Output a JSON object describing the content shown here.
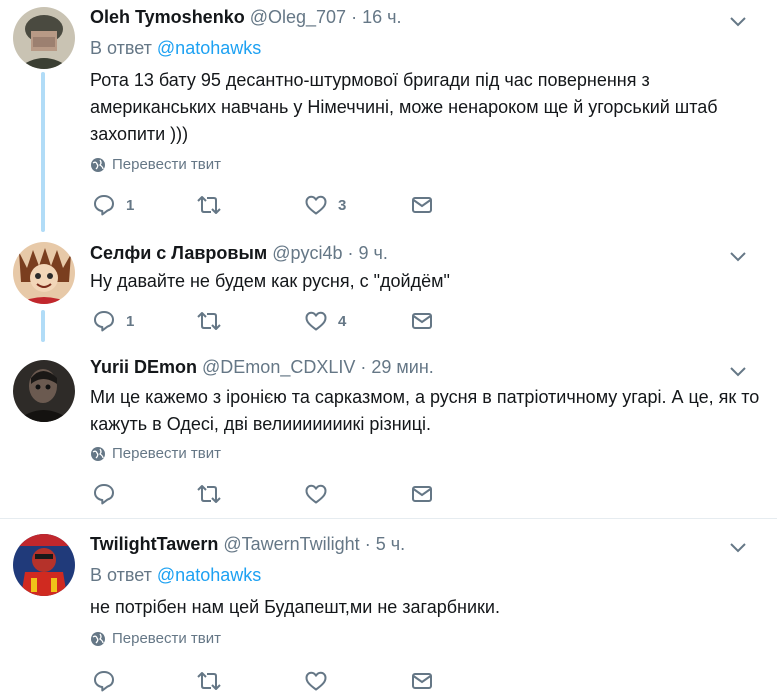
{
  "tweets": [
    {
      "name": "Oleh Tymoshenko",
      "handle": "@Oleg_707",
      "dot": "·",
      "time": "16 ч.",
      "reply_prefix": "В ответ",
      "reply_to": "@natohawks",
      "text": "Рота 13 бату 95 десантно-штурмової бригади під час повернення з американських навчань у Німеччині, може ненароком ще й угорський штаб захопити )))",
      "translate": "Перевести твит",
      "replies": "1",
      "retweets": "",
      "likes": "3"
    },
    {
      "name": "Селфи с Лавровым",
      "handle": "@pyci4b",
      "dot": "·",
      "time": "9 ч.",
      "text": "Ну давайте не будем как русня, с \"дойдём\"",
      "replies": "1",
      "retweets": "",
      "likes": "4"
    },
    {
      "name": "Yurii DEmon",
      "handle": "@DEmon_CDXLIV",
      "dot": "·",
      "time": "29 мин.",
      "text": "Ми це кажемо з іронією та сарказмом, а русня в патріотичному угарі. А це, як то кажуть в Одесі, дві велииииииикі різниці.",
      "translate": "Перевести твит",
      "replies": "",
      "retweets": "",
      "likes": ""
    },
    {
      "name": "TwilightTawern",
      "handle": "@TawernTwilight",
      "dot": "·",
      "time": "5 ч.",
      "reply_prefix": "В ответ",
      "reply_to": "@natohawks",
      "text": "не потрібен нам цей Будапешт,ми не загарбники.",
      "translate": "Перевести твит",
      "replies": "",
      "retweets": "",
      "likes": ""
    }
  ],
  "icons": {
    "reply": "reply-icon",
    "retweet": "retweet-icon",
    "like": "heart-icon",
    "dm": "envelope-icon",
    "caret": "chevron-down-icon",
    "globe": "globe-icon"
  },
  "colors": {
    "link": "#1da1f2",
    "muted": "#657786",
    "thread_line": "#b1dcf7",
    "divider": "#e6ecf0"
  }
}
